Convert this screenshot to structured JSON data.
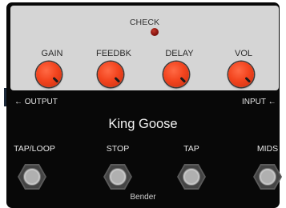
{
  "pedal": {
    "name": "King Goose",
    "brand": "Bender",
    "check_label": "CHECK"
  },
  "knobs": [
    {
      "label": "GAIN"
    },
    {
      "label": "FEEDBK"
    },
    {
      "label": "DELAY"
    },
    {
      "label": "VOL"
    }
  ],
  "jacks": {
    "output": "← OUTPUT",
    "input": "INPUT ←"
  },
  "footswitches": [
    {
      "label": "TAP/LOOP"
    },
    {
      "label": "STOP"
    },
    {
      "label": "TAP"
    },
    {
      "label": "MIDS"
    }
  ],
  "colors": {
    "enclosure": "#080808",
    "panel": "#d5d5d5",
    "knob": "#f3451f",
    "led": "#8a1510",
    "footswitch": "#b5b5b5"
  },
  "icons": {
    "led": "status-led",
    "footswitch": "hexagon-footswitch"
  }
}
